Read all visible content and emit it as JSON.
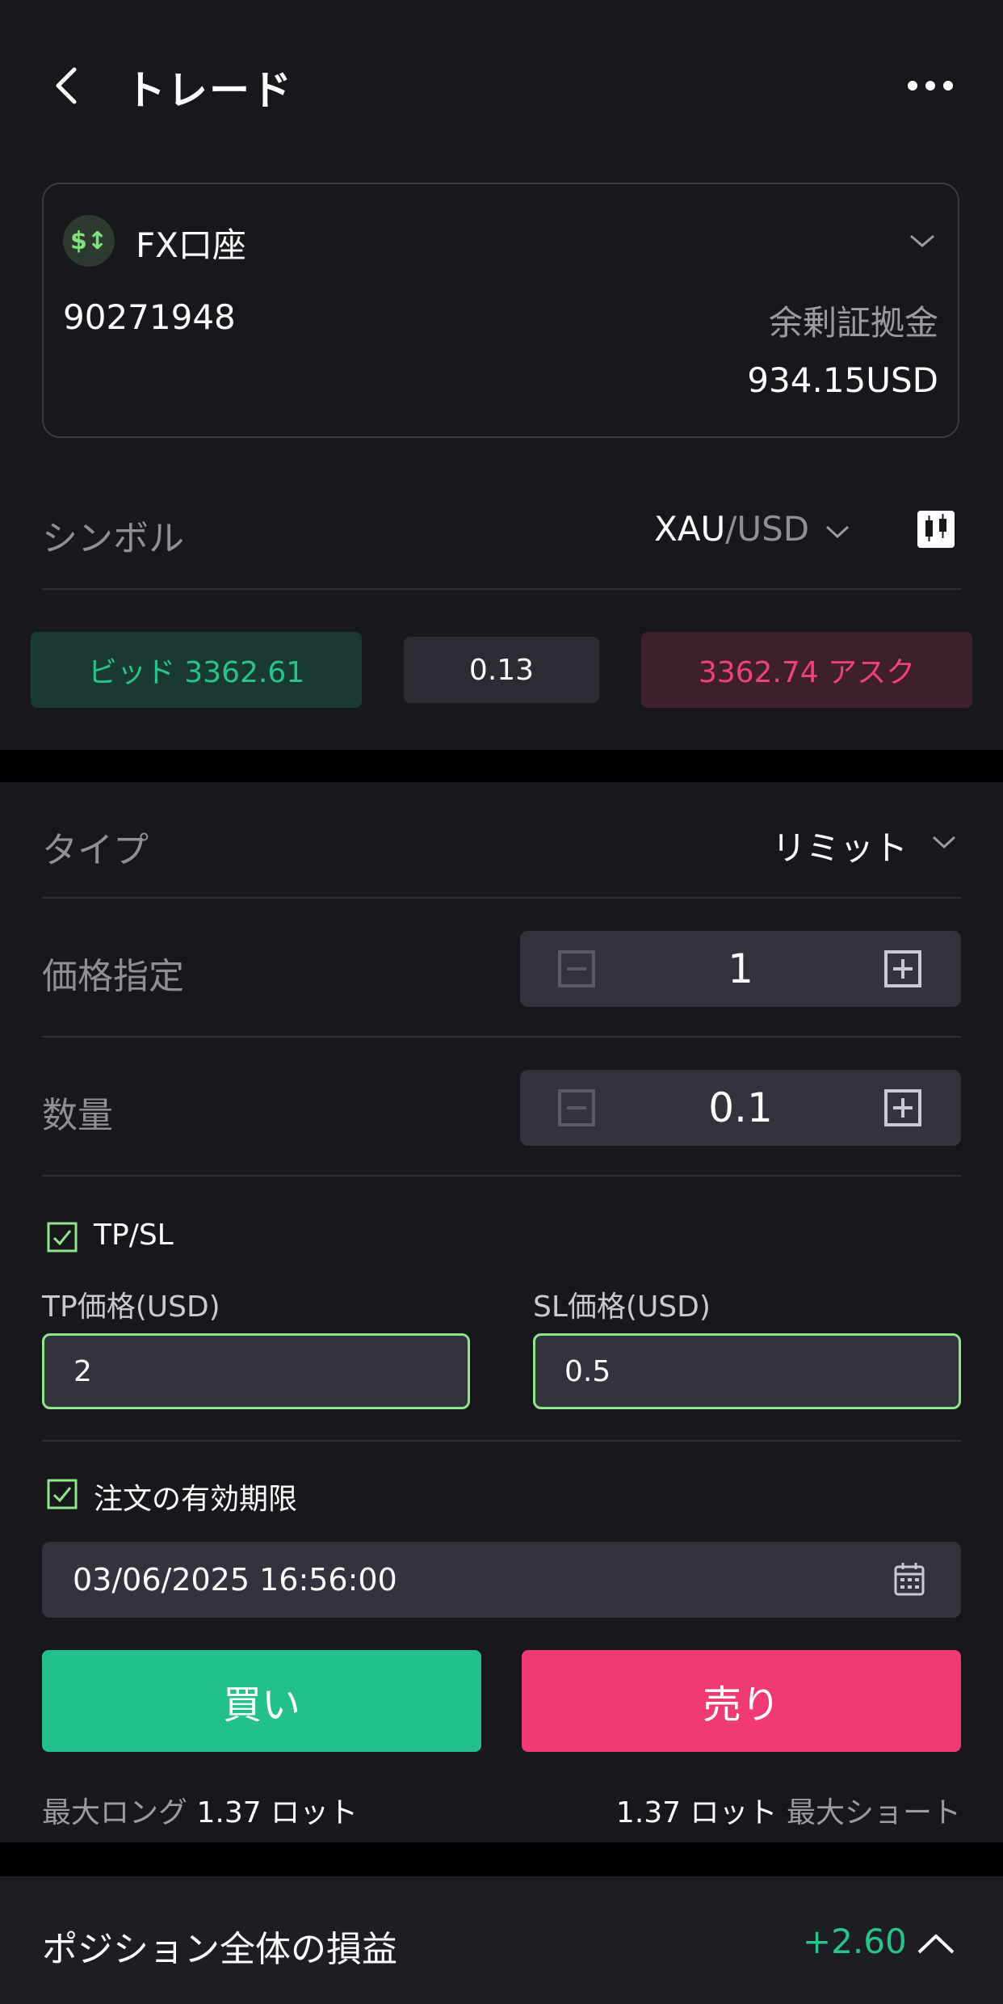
{
  "header": {
    "title": "トレード"
  },
  "account": {
    "name": "FX口座",
    "icon_glyph": "$↕",
    "number": "90271948",
    "margin_label": "余剰証拠金",
    "margin_value": "934.15USD"
  },
  "symbol": {
    "label": "シンボル",
    "base": "XAU",
    "quote": "/USD"
  },
  "quote": {
    "bid": "ビッド 3362.61",
    "spread": "0.13",
    "ask": "3362.74 アスク"
  },
  "order": {
    "type_label": "タイプ",
    "type_value": "リミット",
    "price_label": "価格指定",
    "price_value": "1",
    "qty_label": "数量",
    "qty_value": "0.1",
    "tpsl_label": "TP/SL",
    "tpsl_checked": true,
    "tp_label": "TP価格(USD)",
    "tp_value": "2",
    "sl_label": "SL価格(USD)",
    "sl_value": "0.5",
    "expiry_label": "注文の有効期限",
    "expiry_checked": true,
    "expiry_value": "03/06/2025 16:56:00",
    "buy_label": "買い",
    "sell_label": "売り",
    "max_long_label": "最大ロング",
    "max_long_value": "1.37 ロット",
    "max_short_label": "最大ショート",
    "max_short_value": "1.37 ロット"
  },
  "footer": {
    "pnl_label": "ポジション全体の損益",
    "pnl_value": "+2.60"
  },
  "colors": {
    "background": "#17171c",
    "bid_green": "#29c48a",
    "ask_red": "#f0417a",
    "buy_button": "#23c089",
    "sell_button": "#f03a72",
    "check_green": "#8fe68b"
  }
}
